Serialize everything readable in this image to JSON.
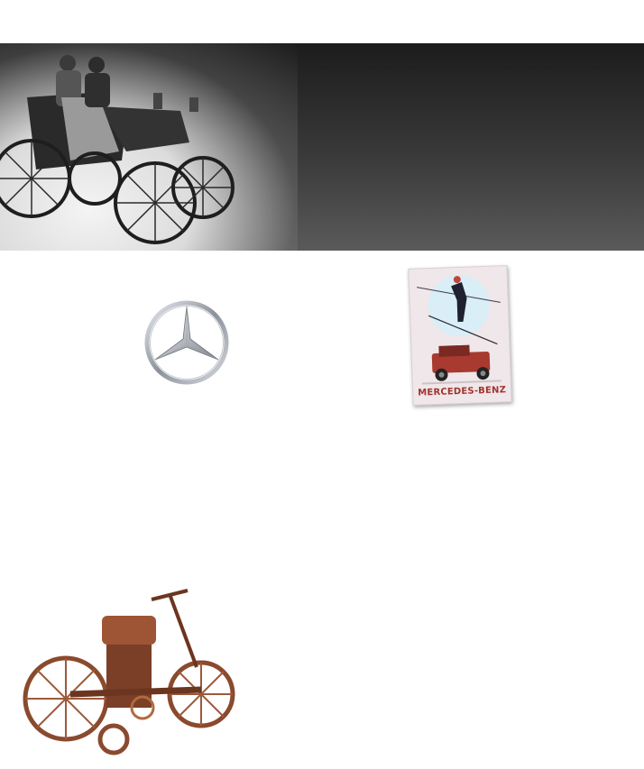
{
  "banner": {
    "image": "vintage-motor-carriage-photo",
    "tone": "black-and-white",
    "gradient": [
      "#1c1c1c",
      "#5a5a5a"
    ]
  },
  "emblem": {
    "icon": "three-pointed-star-icon",
    "color": "#9aa0a8"
  },
  "poster": {
    "brand_text": "MERCEDES-BENZ",
    "accent": "#a4322e"
  },
  "motorcycle": {
    "image": "wooden-motorcycle-illustration",
    "color": "#8a4a2e"
  }
}
